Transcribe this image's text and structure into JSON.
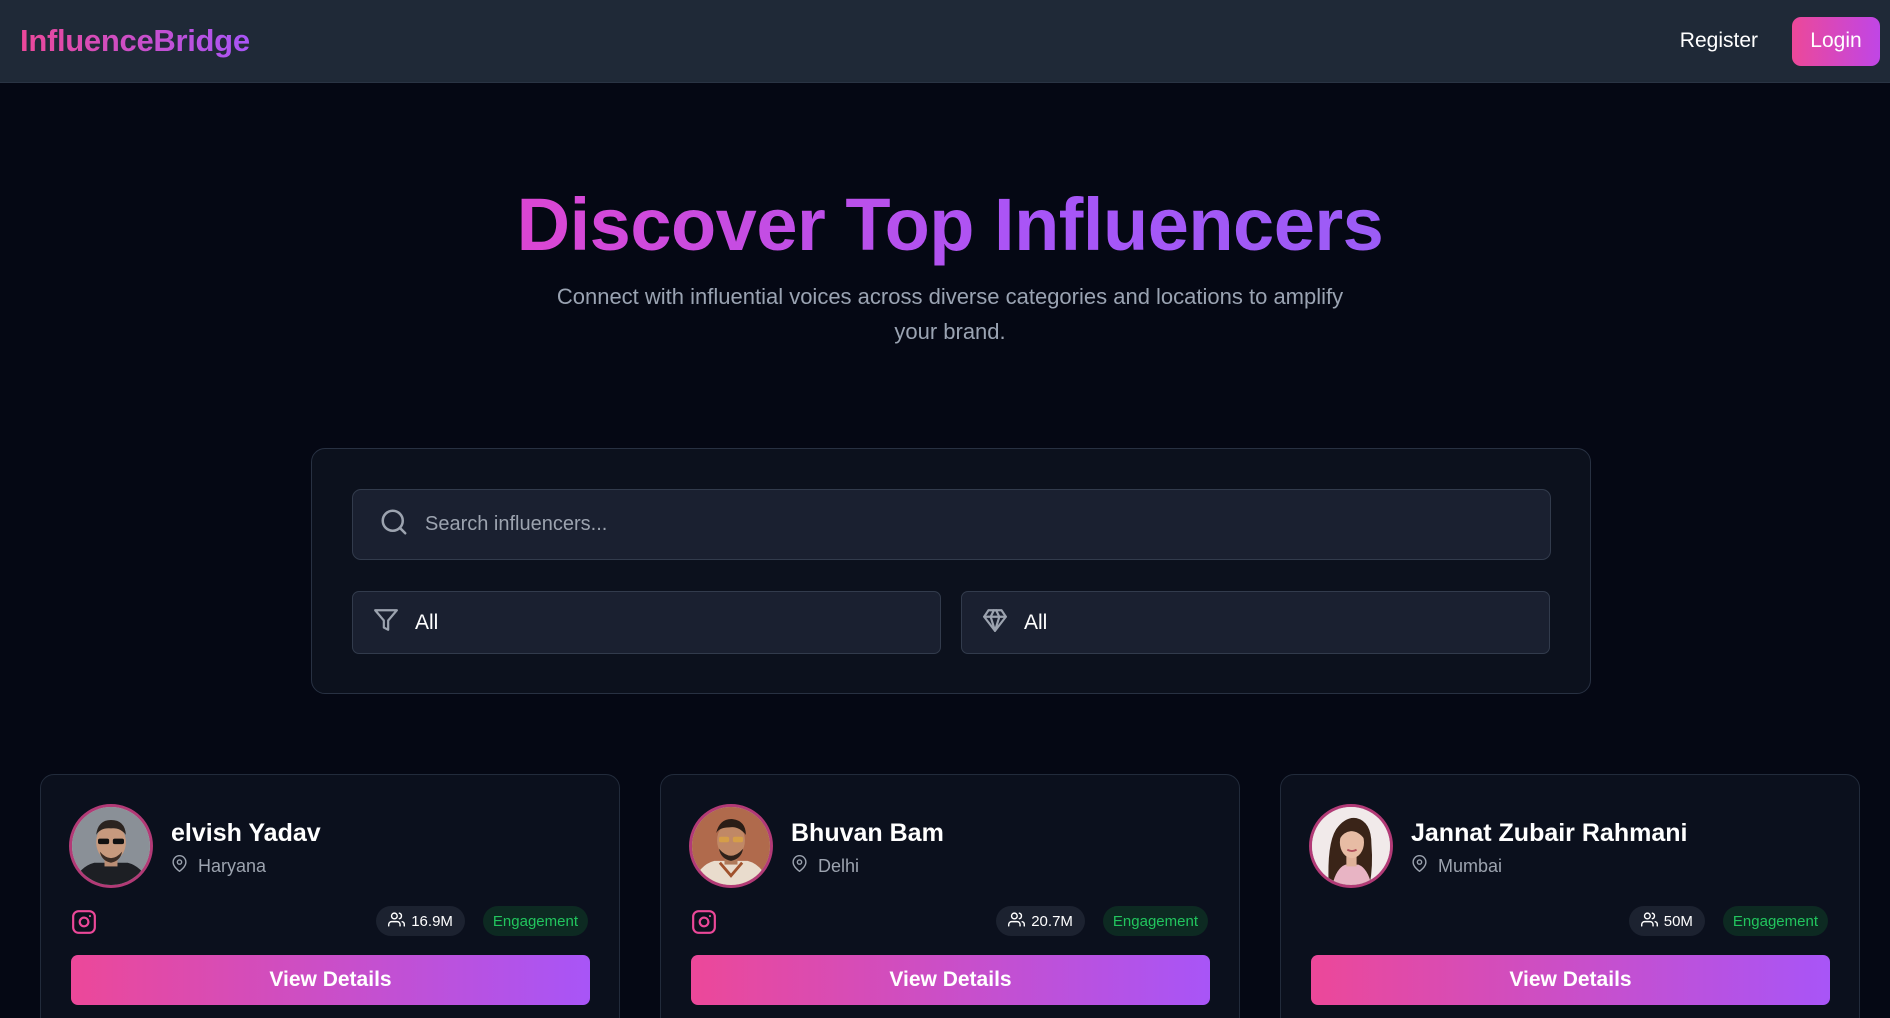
{
  "header": {
    "brand": "InfluenceBridge",
    "register_label": "Register",
    "login_label": "Login"
  },
  "hero": {
    "title": "Discover Top Influencers",
    "subtitle_line1": "Connect with influential voices across diverse categories and locations to amplify",
    "subtitle_line2": "your brand."
  },
  "filters": {
    "search_placeholder": "Search influencers...",
    "category_value": "All",
    "tier_value": "All"
  },
  "influencers": [
    {
      "name": "elvish Yadav",
      "location": "Haryana",
      "followers": "16.9M",
      "engagement_label": "Engagement",
      "platform_icon": "instagram-icon",
      "button_label": "View Details"
    },
    {
      "name": "Bhuvan Bam",
      "location": "Delhi",
      "followers": "20.7M",
      "engagement_label": "Engagement",
      "platform_icon": "instagram-icon",
      "button_label": "View Details"
    },
    {
      "name": "Jannat Zubair Rahmani",
      "location": "Mumbai",
      "followers": "50M",
      "engagement_label": "Engagement",
      "platform_icon": "",
      "button_label": "View Details"
    }
  ],
  "colors": {
    "accent_pink": "#ec4899",
    "accent_purple": "#a855f7",
    "engagement_green": "#22c55e",
    "background": "#050814"
  }
}
